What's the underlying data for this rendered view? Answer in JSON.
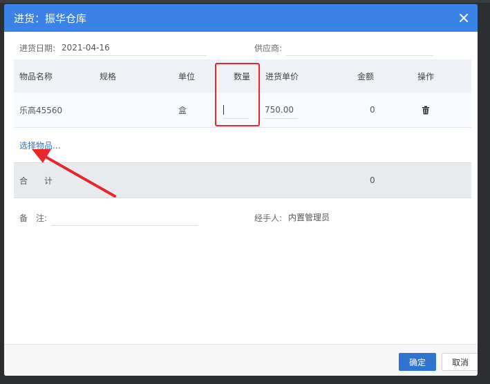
{
  "dialog": {
    "title": "进货：振华仓库"
  },
  "form": {
    "date_label": "进货日期:",
    "date_value": "2021-04-16",
    "supplier_label": "供应商:",
    "supplier_value": "",
    "remark_label": "备　注:",
    "remark_value": "",
    "handler_label": "经手人:",
    "handler_value": "内置管理员"
  },
  "table": {
    "headers": {
      "name": "物品名称",
      "spec": "规格",
      "unit": "单位",
      "qty": "数量",
      "price": "进货单价",
      "amount": "金额",
      "action": "操作"
    },
    "rows": [
      {
        "name": "乐高45560",
        "spec": "",
        "unit": "盒",
        "qty": "",
        "price": "750.00",
        "amount": "0"
      }
    ]
  },
  "select_link": "选择物品...",
  "total": {
    "label_1": "合",
    "label_2": "计",
    "amount": "0"
  },
  "buttons": {
    "ok": "确定",
    "cancel": "取消"
  },
  "colors": {
    "header_blue": "#3b82e6",
    "link_blue": "#2f74d0",
    "annotation_red": "#e8262a"
  },
  "icons": {
    "close": "close-icon",
    "delete": "trash-icon"
  }
}
